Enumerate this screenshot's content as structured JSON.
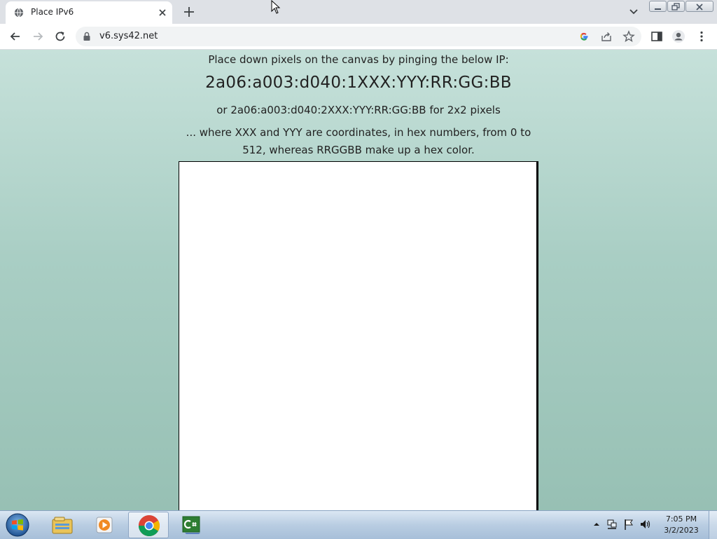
{
  "browser": {
    "tab_title": "Place IPv6",
    "url": "v6.sys42.net"
  },
  "page": {
    "line1": "Place down pixels on the canvas by pinging the below IP:",
    "ip_format": "2a06:a003:d040:1XXX:YYY:RR:GG:BB",
    "line3": "or 2a06:a003:d040:2XXX:YYY:RR:GG:BB for 2x2 pixels",
    "line4": "... where XXX and YYY are coordinates, in hex numbers, from 0 to 512, whereas RRGGBB make up a hex color."
  },
  "taskbar": {
    "apps": [
      {
        "icon": "windows-explorer-icon"
      },
      {
        "icon": "media-player-icon"
      },
      {
        "icon": "chrome-icon",
        "active": true
      },
      {
        "icon": "csharp-icon"
      }
    ],
    "clock_time": "7:05 PM",
    "clock_date": "3/2/2023"
  }
}
